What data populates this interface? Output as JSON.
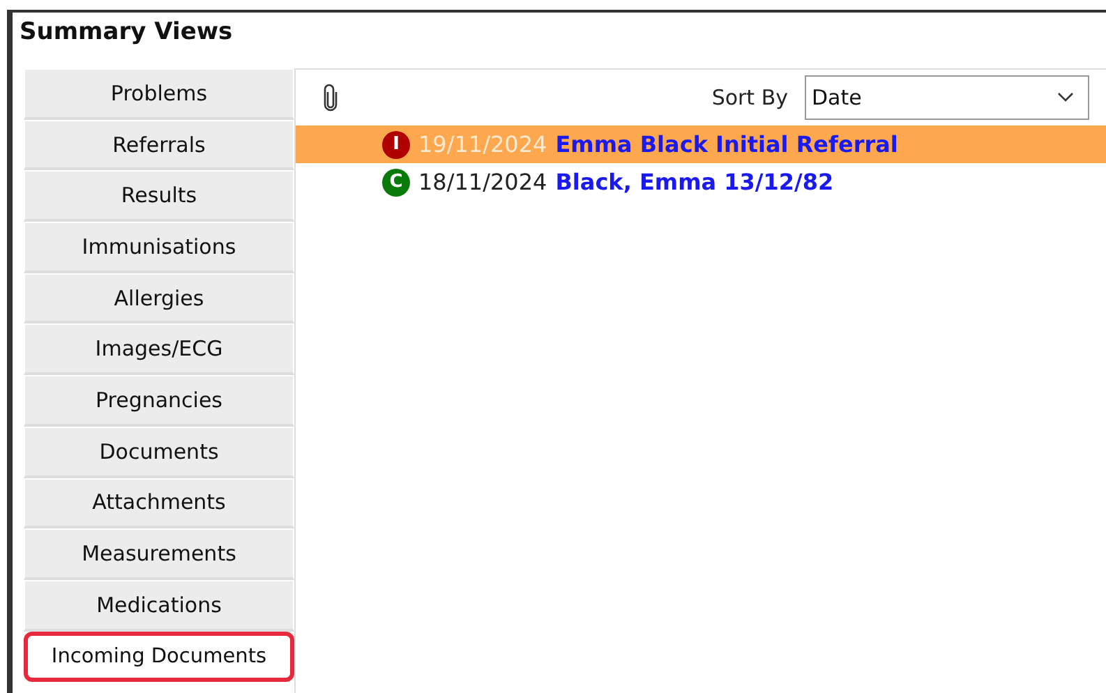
{
  "window": {
    "title": "Summary Views"
  },
  "sidebar": {
    "items": [
      {
        "label": "Problems",
        "selected": false,
        "highlighted": false
      },
      {
        "label": "Referrals",
        "selected": false,
        "highlighted": false
      },
      {
        "label": "Results",
        "selected": false,
        "highlighted": false
      },
      {
        "label": "Immunisations",
        "selected": false,
        "highlighted": false
      },
      {
        "label": "Allergies",
        "selected": false,
        "highlighted": false
      },
      {
        "label": "Images/ECG",
        "selected": false,
        "highlighted": false
      },
      {
        "label": "Pregnancies",
        "selected": false,
        "highlighted": false
      },
      {
        "label": "Documents",
        "selected": false,
        "highlighted": false
      },
      {
        "label": "Attachments",
        "selected": false,
        "highlighted": false
      },
      {
        "label": "Measurements",
        "selected": false,
        "highlighted": false
      },
      {
        "label": "Medications",
        "selected": false,
        "highlighted": false
      },
      {
        "label": "Incoming Documents",
        "selected": true,
        "highlighted": true
      }
    ]
  },
  "toolbar": {
    "sort_label": "Sort By",
    "sort_value": "Date"
  },
  "documents": [
    {
      "status_letter": "I",
      "color": "#b00000",
      "date": "19/11/2024",
      "title": "Emma Black Initial Referral",
      "selected": true
    },
    {
      "status_letter": "C",
      "color": "#0a7a0a",
      "date": "18/11/2024",
      "title": "Black, Emma 13/12/82",
      "selected": false
    }
  ]
}
